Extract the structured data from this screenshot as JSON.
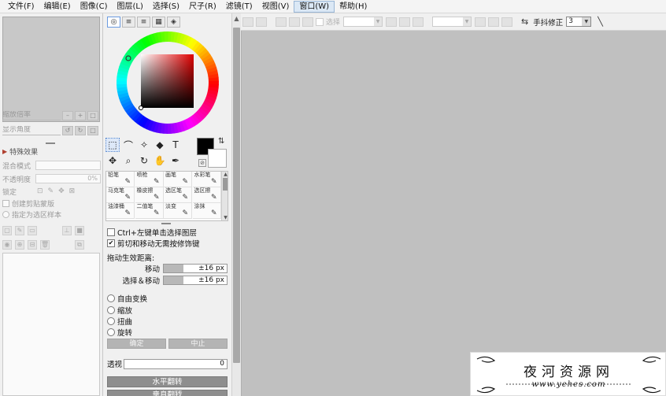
{
  "menu": [
    "文件(F)",
    "编辑(E)",
    "图像(C)",
    "图层(L)",
    "选择(S)",
    "尺子(R)",
    "滤镜(T)",
    "视图(V)",
    "窗口(W)",
    "帮助(H)"
  ],
  "menu_active_index": 8,
  "navigator": {
    "zoom_label": "缩放倍率",
    "rotate_label": "显示角度"
  },
  "layer_panel": {
    "effects_header": "特殊效果",
    "blend_mode_label": "混合模式",
    "opacity_label": "不透明度",
    "opacity_value": "0%",
    "lock_label": "锁定",
    "clipping_label": "创建剪贴蒙版",
    "reference_label": "指定为选区样本"
  },
  "brushes": [
    {
      "name": "铅笔",
      "icon": "pencil-icon"
    },
    {
      "name": "喷枪",
      "icon": "airbrush-icon"
    },
    {
      "name": "画笔",
      "icon": "brush-icon"
    },
    {
      "name": "水彩笔",
      "icon": "watercolor-icon"
    },
    {
      "name": "马克笔",
      "icon": "marker-icon"
    },
    {
      "name": "橡皮擦",
      "icon": "eraser-icon"
    },
    {
      "name": "选区笔",
      "icon": "selection-pen-icon"
    },
    {
      "name": "选区擦",
      "icon": "selection-eraser-icon"
    },
    {
      "name": "油漆桶",
      "icon": "bucket-icon"
    },
    {
      "name": "二值笔",
      "icon": "binary-pen-icon"
    },
    {
      "name": "淡变",
      "icon": "gradient-icon"
    },
    {
      "name": "涂抹",
      "icon": "smudge-icon"
    }
  ],
  "options": {
    "ctrl_select_label": "Ctrl+左键单击选择图层",
    "ctrl_select_checked": false,
    "cut_move_label": "剪切和移动无需按修饰键",
    "cut_move_checked": true,
    "drag_distance_label": "拖动生效距离:",
    "move_label": "移动",
    "move_value": "±16 px",
    "select_move_label": "选择＆移动",
    "select_move_value": "±16 px"
  },
  "transform": {
    "free_label": "自由变换",
    "scale_label": "缩放",
    "distort_label": "扭曲",
    "rotate_label": "旋转",
    "ok_label": "确定",
    "cancel_label": "中止",
    "perspective_label": "透视",
    "perspective_value": "0",
    "flip_h_label": "水平翻转",
    "flip_v_label": "垂直翻转"
  },
  "toolbar": {
    "selection_label": "选择",
    "stabilizer_label": "手抖修正",
    "stabilizer_value": "3"
  },
  "colors": {
    "foreground": "#000000",
    "background": "#ffffff",
    "canvas": "#c0c0c0",
    "accent": "#6b9be0"
  },
  "watermark": {
    "title": "夜河资源网",
    "url": "www.yehes.com"
  }
}
